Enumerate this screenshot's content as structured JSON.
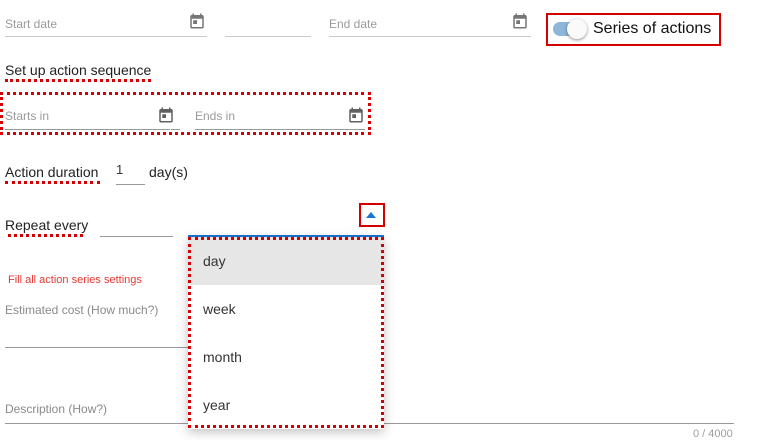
{
  "date_row": {
    "start_date_placeholder": "Start date",
    "end_date_placeholder": "End date"
  },
  "series_toggle": {
    "label": "Series of actions",
    "on": true
  },
  "sequence": {
    "heading": "Set up action sequence",
    "starts_in_placeholder": "Starts in",
    "ends_in_placeholder": "Ends in"
  },
  "duration": {
    "label": "Action duration",
    "value": "1",
    "unit": "day(s)"
  },
  "repeat": {
    "label": "Repeat every",
    "options": [
      "day",
      "week",
      "month",
      "year"
    ],
    "highlighted_option": "day"
  },
  "error_message": "Fill all action series settings",
  "estimated_cost_label": "Estimated cost (How much?)",
  "description_label": "Description (How?)",
  "description_counter": "0 / 4000",
  "colors": {
    "accent": "#1976d2",
    "error": "#e53935",
    "annotation": "#d40000",
    "toggle_track": "#8db6d9"
  }
}
